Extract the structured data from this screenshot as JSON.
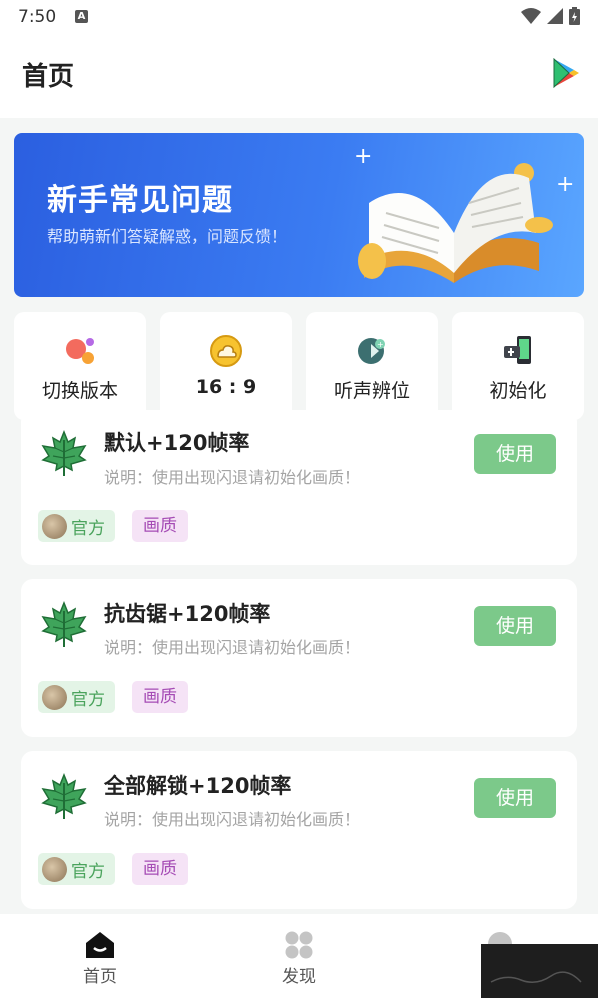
{
  "status_bar": {
    "time": "7:50",
    "notification_icon": "a-icon"
  },
  "app_bar": {
    "title": "首页",
    "action_icon": "play-store-icon"
  },
  "banner": {
    "title": "新手常见问题",
    "subtitle": "帮助萌新们答疑解惑，问题反馈！"
  },
  "quick_actions": [
    {
      "label": "切换版本",
      "icon": "switch-version-icon"
    },
    {
      "label": "16 : 9",
      "icon": "cloud-ratio-icon"
    },
    {
      "label": "听声辨位",
      "icon": "sound-position-icon"
    },
    {
      "label": "初始化",
      "icon": "initialize-icon"
    }
  ],
  "configs": [
    {
      "title": "默认+120帧率",
      "desc": "说明：使用出现闪退请初始化画质！",
      "button": "使用",
      "tags": [
        "官方",
        "画质"
      ]
    },
    {
      "title": "抗齿锯+120帧率",
      "desc": "说明：使用出现闪退请初始化画质！",
      "button": "使用",
      "tags": [
        "官方",
        "画质"
      ]
    },
    {
      "title": "全部解锁+120帧率",
      "desc": "说明：使用出现闪退请初始化画质！",
      "button": "使用",
      "tags": [
        "官方",
        "画质"
      ]
    }
  ],
  "tabs": [
    {
      "label": "首页",
      "icon": "home-icon",
      "active": true
    },
    {
      "label": "发现",
      "icon": "discover-icon",
      "active": false
    }
  ],
  "colors": {
    "accent": "#7cc98a",
    "banner": "#3b7cf2",
    "tag_official": "#4aa35c",
    "tag_quality": "#a54cb5"
  }
}
